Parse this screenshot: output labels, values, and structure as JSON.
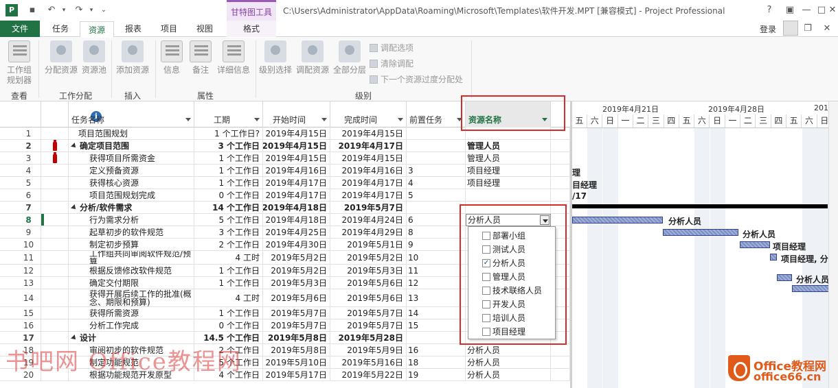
{
  "app": {
    "window_title": "C:\\Users\\Administrator\\AppData\\Roaming\\Microsoft\\Templates\\软件开发.MPT [兼容模式] - Project Professional",
    "context_group": "甘特图工具",
    "help": "?",
    "login": "登录"
  },
  "tabs": [
    "文件",
    "任务",
    "资源",
    "报表",
    "项目",
    "视图",
    "格式"
  ],
  "ribbon": {
    "buttons": [
      {
        "label": "工作组\n规划器"
      },
      {
        "label": "分配资源"
      },
      {
        "label": "资源池"
      },
      {
        "label": "添加资源"
      },
      {
        "label": "信息"
      },
      {
        "label": "备注"
      },
      {
        "label": "详细信息"
      },
      {
        "label": "级别选择"
      },
      {
        "label": "调配资源"
      },
      {
        "label": "全部分层"
      }
    ],
    "small": [
      "调配选项",
      "清除调配",
      "下一个资源过度分配处"
    ],
    "groups": [
      "查看",
      "工作分配",
      "插入",
      "属性",
      "级别"
    ]
  },
  "columns": {
    "name": "任务名称",
    "duration": "工期",
    "start": "开始时间",
    "finish": "完成时间",
    "predecessors": "前置任务",
    "resources": "资源名称"
  },
  "rows": [
    {
      "id": "1",
      "name": "项目范围规划",
      "dur": "1 个工作日?",
      "start": "2019年4月15日",
      "finish": "2019年4月15日",
      "pred": "",
      "res": ""
    },
    {
      "id": "2",
      "name": "确定项目范围",
      "dur": "3 个工作日",
      "start": "2019年4月15日",
      "finish": "2019年4月17日",
      "pred": "",
      "res": "管理人员"
    },
    {
      "id": "3",
      "name": "获得项目所需资金",
      "dur": "1 个工作日",
      "start": "2019年4月15日",
      "finish": "2019年4月15日",
      "pred": "",
      "res": "管理人员"
    },
    {
      "id": "4",
      "name": "定义预备资源",
      "dur": "1 个工作日",
      "start": "2019年4月16日",
      "finish": "2019年4月16日",
      "pred": "3",
      "res": "项目经理"
    },
    {
      "id": "5",
      "name": "获得核心资源",
      "dur": "1 个工作日",
      "start": "2019年4月17日",
      "finish": "2019年4月17日",
      "pred": "4",
      "res": "项目经理"
    },
    {
      "id": "6",
      "name": "项目范围规划完成",
      "dur": "0 个工作日",
      "start": "2019年4月17日",
      "finish": "2019年4月17日",
      "pred": "5",
      "res": ""
    },
    {
      "id": "7",
      "name": "分析/软件需求",
      "dur": "14 个工作日",
      "start": "2019年4月18日",
      "finish": "2019年5月7日",
      "pred": "",
      "res": ""
    },
    {
      "id": "8",
      "name": "行为需求分析",
      "dur": "5 个工作日",
      "start": "2019年4月18日",
      "finish": "2019年4月24日",
      "pred": "6",
      "res": "分析人员"
    },
    {
      "id": "9",
      "name": "起草初步的软件规范",
      "dur": "3 个工作日",
      "start": "2019年4月25日",
      "finish": "2019年4月29日",
      "pred": "8",
      "res": ""
    },
    {
      "id": "10",
      "name": "制定初步预算",
      "dur": "2 个工作日",
      "start": "2019年4月30日",
      "finish": "2019年5月1日",
      "pred": "9",
      "res": ""
    },
    {
      "id": "11",
      "name": "工作组共同审阅软件规范/预算",
      "dur": "4 工时",
      "start": "2019年5月2日",
      "finish": "2019年5月2日",
      "pred": "10",
      "res": ""
    },
    {
      "id": "12",
      "name": "根据反馈修改软件规范",
      "dur": "1 个工作日",
      "start": "2019年5月2日",
      "finish": "2019年5月3日",
      "pred": "11",
      "res": ""
    },
    {
      "id": "13",
      "name": "确定交付期限",
      "dur": "1 个工作日",
      "start": "2019年5月3日",
      "finish": "2019年5月6日",
      "pred": "12",
      "res": ""
    },
    {
      "id": "14",
      "name": "获得开展后续工作的批准(概念、期限和预算)",
      "dur": "4 工时",
      "start": "2019年5月6日",
      "finish": "2019年5月6日",
      "pred": "13",
      "res": ""
    },
    {
      "id": "15",
      "name": "获得所需资源",
      "dur": "1 个工作日",
      "start": "2019年5月7日",
      "finish": "2019年5月7日",
      "pred": "14",
      "res": ""
    },
    {
      "id": "16",
      "name": "分析工作完成",
      "dur": "0 个工作日",
      "start": "2019年5月7日",
      "finish": "2019年5月7日",
      "pred": "15",
      "res": ""
    },
    {
      "id": "17",
      "name": "设计",
      "dur": "14.5 个工作日",
      "start": "2019年5月8日",
      "finish": "2019年5月28日",
      "pred": "",
      "res": ""
    },
    {
      "id": "18",
      "name": "审阅初步的软件规范",
      "dur": "2 个工作日",
      "start": "2019年5月8日",
      "finish": "2019年5月9日",
      "pred": "16",
      "res": "分析人员"
    },
    {
      "id": "19",
      "name": "制定功能规范",
      "dur": "5 个工作日",
      "start": "2019年5月10日",
      "finish": "2019年5月16日",
      "pred": "18",
      "res": "分析人员"
    },
    {
      "id": "20",
      "name": "根据功能规范开发原型",
      "dur": "4 个工作日",
      "start": "2019年5月17日",
      "finish": "2019年5月22日",
      "pred": "19",
      "res": "分析人员"
    }
  ],
  "dropdown": {
    "value": "分析人员",
    "options": [
      {
        "label": "部署小组",
        "checked": false
      },
      {
        "label": "测试人员",
        "checked": false
      },
      {
        "label": "分析人员",
        "checked": true
      },
      {
        "label": "管理人员",
        "checked": false
      },
      {
        "label": "技术联络人员",
        "checked": false
      },
      {
        "label": "开发人员",
        "checked": false
      },
      {
        "label": "培训人员",
        "checked": false
      },
      {
        "label": "项目经理",
        "checked": false
      }
    ]
  },
  "gantt": {
    "weeks": [
      "2019年4月21日",
      "2019年4月28日",
      "201"
    ],
    "days": [
      "五",
      "六",
      "日",
      "一",
      "二",
      "三",
      "四",
      "五",
      "六",
      "日",
      "一",
      "二",
      "三",
      "四",
      "五",
      "六",
      "日"
    ],
    "labels": [
      "理",
      "目经理",
      "/17",
      "分析人员",
      "分析人员",
      "项目经理",
      "项目经理, 分",
      "分析人员"
    ]
  },
  "watermark": "书吧网 Office教程网",
  "brand": {
    "line1": "Office教程网",
    "line2": "office66.cn"
  }
}
